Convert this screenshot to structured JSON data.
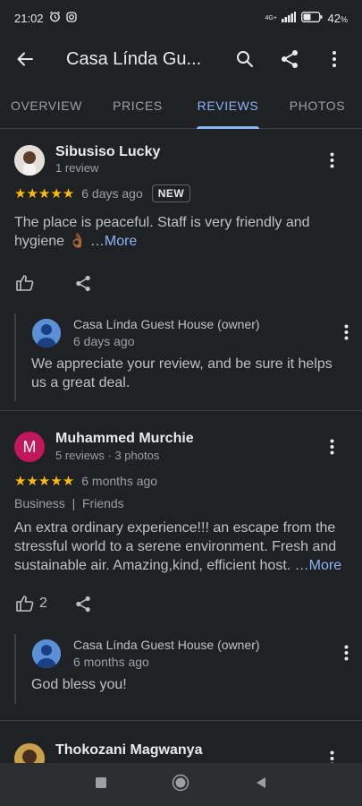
{
  "status": {
    "time": "21:02",
    "network": "4G+",
    "battery": "42"
  },
  "appbar": {
    "title": "Casa Línda Gu..."
  },
  "tabs": [
    {
      "label": "OVERVIEW"
    },
    {
      "label": "PRICES"
    },
    {
      "label": "REVIEWS"
    },
    {
      "label": "PHOTOS"
    }
  ],
  "reviews": [
    {
      "name": "Sibusiso Lucky",
      "meta": "1 review",
      "stars": "★★★★★",
      "time": "6 days ago",
      "badge": "NEW",
      "text": "The place is peaceful. Staff is very friendly and hygiene 👌🏾 …",
      "more": "More",
      "likes": "",
      "owner": {
        "name": "Casa Línda Guest House (owner)",
        "time": "6 days ago",
        "text": "We appreciate your review, and be sure it helps us a great deal."
      }
    },
    {
      "name": "Muhammed Murchie",
      "initial": "M",
      "meta": "5 reviews · 3 photos",
      "stars": "★★★★★",
      "time": "6 months ago",
      "tags": "Business  |  Friends",
      "text": "An extra ordinary experience!!! an escape from the stressful world to a serene environment. Fresh and sustainable air. Amazing,kind, efficient host. …",
      "more": "More",
      "likes": "2",
      "owner": {
        "name": "Casa Línda Guest House (owner)",
        "time": "6 months ago",
        "text": "God bless you!"
      }
    },
    {
      "name": "Thokozani Magwanya"
    }
  ],
  "colors": {
    "accent": "#8ab4f8",
    "star": "#fbbc04",
    "background": "#202124"
  }
}
